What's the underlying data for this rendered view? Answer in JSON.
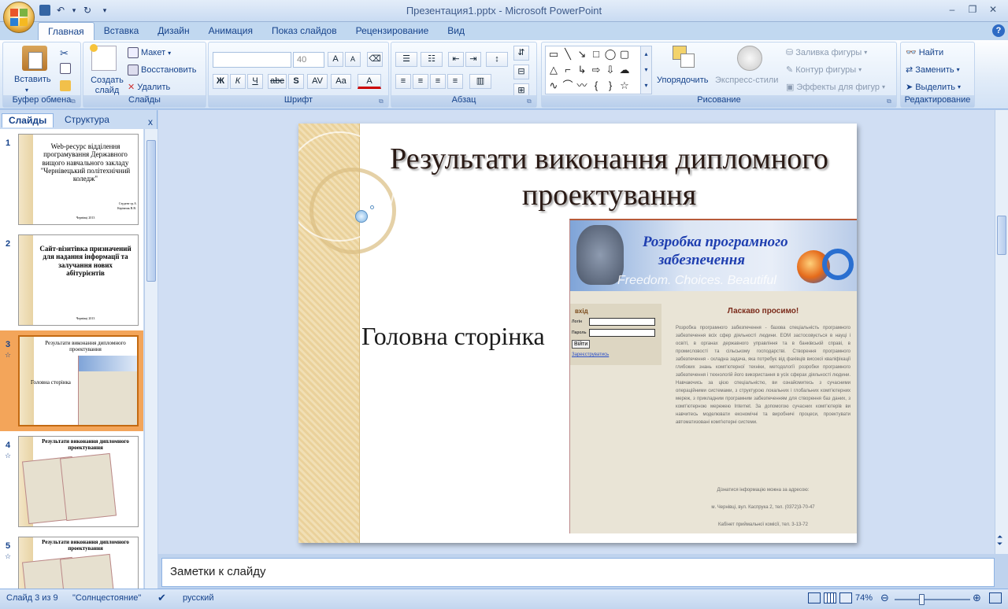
{
  "window": {
    "title": "Презентация1.pptx - Microsoft PowerPoint",
    "minimize": "–",
    "restore": "❐",
    "close": "✕"
  },
  "qat": {
    "save": "💾",
    "undo": "↶",
    "redo": "↻",
    "more": "▾"
  },
  "tabs": [
    "Главная",
    "Вставка",
    "Дизайн",
    "Анимация",
    "Показ слайдов",
    "Рецензирование",
    "Вид"
  ],
  "help": "?",
  "ribbon": {
    "clipboard": {
      "label": "Буфер обмена",
      "paste": "Вставить"
    },
    "slides": {
      "label": "Слайды",
      "new_slide": "Создать слайд",
      "layout": "Макет",
      "reset": "Восстановить",
      "delete": "Удалить"
    },
    "font": {
      "label": "Шрифт",
      "font_name": "",
      "font_size": "40",
      "bold": "Ж",
      "italic": "К",
      "underline": "Ч",
      "strike": "abc",
      "shadow": "S",
      "spacing": "AV",
      "case": "Aa",
      "color": "A"
    },
    "paragraph": {
      "label": "Абзац"
    },
    "drawing": {
      "label": "Рисование",
      "arrange": "Упорядочить",
      "quick_styles": "Экспресс-стили",
      "fill": "Заливка фигуры",
      "outline": "Контур фигуры",
      "effects": "Эффекты для фигур"
    },
    "editing": {
      "label": "Редактирование",
      "find": "Найти",
      "replace": "Заменить",
      "select": "Выделить"
    }
  },
  "left_panel": {
    "tab_slides": "Слайды",
    "tab_outline": "Структура",
    "close": "x",
    "slides": [
      {
        "num": "1",
        "title": "Web-ресурс відділення програмування Державного вищого навчального закладу \"Чернівецький політехнічний коледж\"",
        "author1": "Студент гр.А",
        "author2": "Керівник В.В.",
        "footer": "Чернівці 2013"
      },
      {
        "num": "2",
        "title": "Сайт-візитівка призначений для надання інформації та залучання нових абітурієнтів",
        "footer": "Чернівці 2013"
      },
      {
        "num": "3",
        "title": "Результати виконання дипломного проектування",
        "label": "Головна сторінка"
      },
      {
        "num": "4",
        "title": "Результати виконання дипломного проектування"
      },
      {
        "num": "5",
        "title": "Результати виконання дипломного проектування"
      }
    ]
  },
  "slide": {
    "title": "Результати виконання дипломного проектування",
    "label": "Головна сторінка",
    "web": {
      "banner_title_1": "Розробка програмного",
      "banner_title_2": "забезпечення",
      "banner_sub": "Freedom. Choices. Beautiful",
      "login_header": "вхід",
      "login_label": "Логін",
      "password_label": "Пароль",
      "login_button": "Війти",
      "register_link": "Зареєструватись",
      "welcome": "Ласкаво просимо!",
      "body": "Розробка програмного забезпечення - базова спеціальність програмного забезпечення всіх сфер діяльності людини. ЕОМ застосовується в науці і освіті, в органах державного управління та в банківській справі, в промисловості та сільському господарстві. Створення програмного забезпечення - складна задача, яка потребує від фахівців високої кваліфікації глибоких знань комп'ютерної техніки, методології розробки програмного забезпечення і технологій його використання в усіх сферах діяльності людини. Навчаючись за цією спеціальністю, ви ознайомитесь з сучасними операційними системами, з структурою локальних і глобальних комп'ютерних мереж, з прикладним програмним забезпеченням для створення баз даних, з комп'ютерною мережею Internet. За допомогою сучасних комп'ютерів ви навчитесь моделювати економічні та виробничі процеси, проектувати автоматизовані комп'ютерні системи.",
      "foot1": "Дізнатися інформацію можна за адресою:",
      "foot2": "м. Чернівці, вул. Каспрука 2, тел. (0372)3-70-47",
      "foot3": "Кабінет приймальної комісії, тел. 3-13-72"
    }
  },
  "notes_placeholder": "Заметки к слайду",
  "status": {
    "slide_info": "Слайд 3 из 9",
    "theme": "\"Солнцестояние\"",
    "language": "русский",
    "zoom": "74%",
    "zoom_level": 0.74
  }
}
